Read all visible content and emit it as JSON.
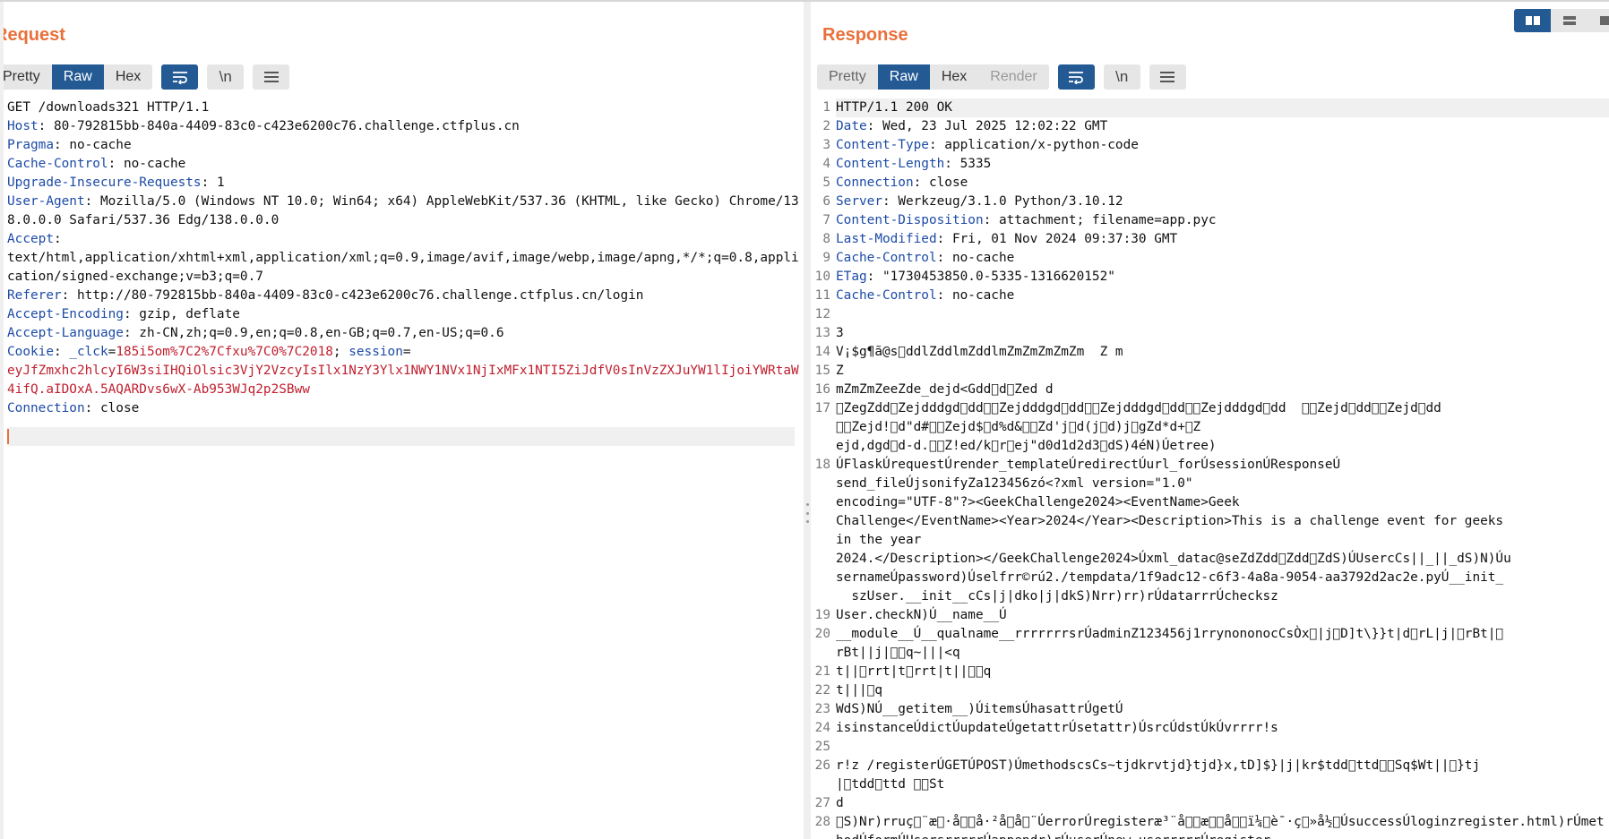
{
  "request": {
    "title": "Request",
    "tabs": [
      {
        "label": "Pretty",
        "active": false
      },
      {
        "label": "Raw",
        "active": true
      },
      {
        "label": "Hex",
        "active": false
      }
    ],
    "newline_label": "\\n",
    "lines": [
      {
        "plain": "GET /downloads321 HTTP/1.1"
      },
      {
        "name": "Host",
        "value": "80-792815bb-840a-4409-83c0-c423e6200c76.challenge.ctfplus.cn"
      },
      {
        "name": "Pragma",
        "value": "no-cache"
      },
      {
        "name": "Cache-Control",
        "value": "no-cache"
      },
      {
        "name": "Upgrade-Insecure-Requests",
        "value": "1"
      },
      {
        "name": "User-Agent",
        "value": "Mozilla/5.0 (Windows NT 10.0; Win64; x64) AppleWebKit/537.36 (KHTML, like Gecko) Chrome/138.0.0.0 Safari/537.36 Edg/138.0.0.0"
      },
      {
        "name": "Accept",
        "value": "text/html,application/xhtml+xml,application/xml;q=0.9,image/avif,image/webp,image/apng,*/*;q=0.8,application/signed-exchange;v=b3;q=0.7",
        "newline": true
      },
      {
        "name": "Referer",
        "value": "http://80-792815bb-840a-4409-83c0-c423e6200c76.challenge.ctfplus.cn/login"
      },
      {
        "name": "Accept-Encoding",
        "value": "gzip, deflate"
      },
      {
        "name": "Accept-Language",
        "value": "zh-CN,zh;q=0.9,en;q=0.8,en-GB;q=0.7,en-US;q=0.6"
      },
      {
        "cookie": true,
        "name": "Cookie",
        "c1name": "_clck",
        "c1value": "185i5om%7C2%7Cfxu%7C0%7C2018",
        "c2name": "session",
        "c2value": "eyJfZmxhc2hlcyI6W3siIHQiOlsic3VjY2VzcyIsIlx1NzY3Ylx1NWY1NVx1NjIxMFx1NTI5ZiJdfV0sInVzZXJuYW1lIjoiYWRtaW4ifQ.aIDOxA.5AQARDvs6wX-Ab953WJq2p2SBww"
      },
      {
        "name": "Connection",
        "value": "close"
      }
    ]
  },
  "response": {
    "title": "Response",
    "tabs": [
      {
        "label": "Pretty",
        "active": false
      },
      {
        "label": "Raw",
        "active": true
      },
      {
        "label": "Hex",
        "active": false
      },
      {
        "label": "Render",
        "active": false,
        "muted": true
      }
    ],
    "newline_label": "\\n",
    "lines": [
      {
        "n": "1",
        "plain": "HTTP/1.1 200 OK",
        "highlight": true
      },
      {
        "n": "2",
        "name": "Date",
        "value": "Wed, 23 Jul 2025 12:02:22 GMT"
      },
      {
        "n": "3",
        "name": "Content-Type",
        "value": "application/x-python-code"
      },
      {
        "n": "4",
        "name": "Content-Length",
        "value": "5335"
      },
      {
        "n": "5",
        "name": "Connection",
        "value": "close"
      },
      {
        "n": "6",
        "name": "Server",
        "value": "Werkzeug/3.1.0 Python/3.10.12"
      },
      {
        "n": "7",
        "name": "Content-Disposition",
        "value": "attachment; filename=app.pyc"
      },
      {
        "n": "8",
        "name": "Last-Modified",
        "value": "Fri, 01 Nov 2024 09:37:30 GMT"
      },
      {
        "n": "9",
        "name": "Cache-Control",
        "value": "no-cache"
      },
      {
        "n": "10",
        "name": "ETag",
        "value": "\"1730453850.0-5335-1316620152\""
      },
      {
        "n": "11",
        "name": "Cache-Control",
        "value": "no-cache"
      },
      {
        "n": "12",
        "plain": ""
      },
      {
        "n": "13",
        "plain": "3"
      },
      {
        "n": "14",
        "plain": "V¡$g¶ã@s\u0000ddlZddlmZddlmZmZmZmZmZm  Z m"
      },
      {
        "n": "15",
        "plain": "Z"
      },
      {
        "n": "16",
        "plain": "mZmZmZeeZde_dejd<Gdd\u0000d\u0000Zed d"
      },
      {
        "n": "17",
        "plain": "\u0000ZegZdd\u0000Zejdddgd\u0000dd\u0000\u0000Zejdddgd\u0000dd\u0000\u0000Zejdddgd\u0000dd\u0000\u0000Zejdddgd\u0000dd  \u0000\u0000Zejd\u0000dd\u0000\u0000Zejd\u0000dd\n\u0000\u0000Zejd!\u0000d\"d#\u0000\u0000Zejd$\u0000d%d&\u0000\u0000Zd'j\u0000d(j\u0000d)j\u0000gZd*d+\u0000Z\nejd,dgd\u0000d-d.\u0000\u0000Z!ed/k\u0000r\u0000ej\"d0d1d2d3\u0000dS)4éN)Úetree)"
      },
      {
        "n": "18",
        "plain": "ÚFlaskÚrequestÚrender_templateÚredirectÚurl_forÚsessionÚResponseÚ\nsend_fileÚjsonifyZa123456zó<?xml version=\"1.0\"\nencoding=\"UTF-8\"?><GeekChallenge2024><EventName>Geek\nChallenge</EventName><Year>2024</Year><Description>This is a challenge event for geeks\nin the year\n2024.</Description></GeekChallenge2024>Úxml_datac@seZdZdd\u0000Zdd\u0000ZdS)ÚUsercCs||_||_dS)N)Úu\nsernameÚpassword)Úselfrr©rú2./tempdata/1f9adc12-c6f3-4a8a-9054-aa3792d2ac2e.pyÚ__init_\n  szUser.__init__cCs|j|dko|j|dkS)Nrr)rr)rÚdatarrrÚchecksz"
      },
      {
        "n": "19",
        "plain": "User.checkN)Ú__name__Ú"
      },
      {
        "n": "20",
        "plain": "__module__Ú__qualname__rrrrrrrsrÚadminZ123456j1rrynononocCsÒx\u0000|j\u0000D]t\\}}t|d\u0000rL|j|\u0000rBt|\u0000\nrBt||j|\u0000\u0000q~|||<q"
      },
      {
        "n": "21",
        "plain": "t||\u0000rrt|t\u0000rrt|t||\u0000\u0000q"
      },
      {
        "n": "22",
        "plain": "t|||\u0000q"
      },
      {
        "n": "23",
        "plain": "WdS)NÚ__getitem__)ÚitemsÚhasattrÚgetÚ"
      },
      {
        "n": "24",
        "plain": "isinstanceÚdictÚupdateÚgetattrÚsetattr)ÚsrcÚdstÚkÚvrrrr!s"
      },
      {
        "n": "25",
        "plain": ""
      },
      {
        "n": "26",
        "plain": "r!z /registerÚGETÚPOST)ÚmethodscsCs~tjdkrvtjd}tjd}x,tD]$}|j|kr$tdd\u0000ttd\u0000\u0000Sq$Wt||\u0000}tj\n|\u0000tdd\u0000ttd \u0000\u0000St"
      },
      {
        "n": "27",
        "plain": "d"
      },
      {
        "n": "28",
        "plain": "\u0000S)Nr)rruç\u0000¨æ\u0000·å\u0000\u0000å·²å­\u0000å\u0000¨ÚerrorÚregisteræ³¨å\u0000\u0000æ\u0000\u0000å\u0000\u0000ï¼\u0000è¯·ç\u0000»å½\u0000ÚsuccessÚloginzregister.html)rÚmethodÚformÚUsersrrrrrÚappendr)rÚuserÚnew_userrrrrÚregister"
      }
    ]
  }
}
